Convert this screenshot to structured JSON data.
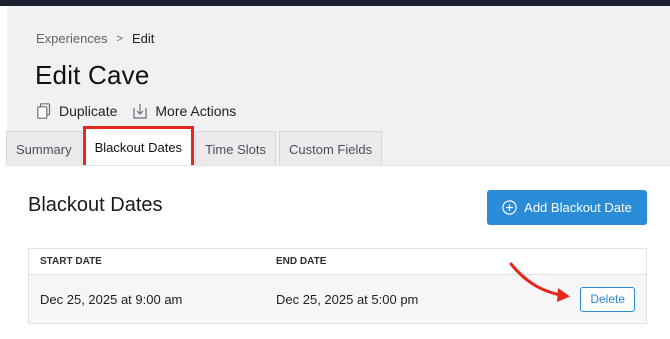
{
  "breadcrumb": {
    "parent": "Experiences",
    "separator": ">",
    "current": "Edit"
  },
  "page": {
    "title": "Edit Cave"
  },
  "actions": [
    {
      "label": "Duplicate",
      "icon": "duplicate-icon"
    },
    {
      "label": "More Actions",
      "icon": "download-icon"
    }
  ],
  "tabs": [
    {
      "label": "Summary",
      "active": false
    },
    {
      "label": "Blackout Dates",
      "active": true
    },
    {
      "label": "Time Slots",
      "active": false
    },
    {
      "label": "Custom Fields",
      "active": false
    }
  ],
  "section": {
    "title": "Blackout Dates",
    "add_button_label": "Add Blackout Date",
    "add_button_icon": "plus-circle-icon"
  },
  "table": {
    "columns": [
      "START DATE",
      "END DATE"
    ],
    "rows": [
      {
        "start": "Dec 25, 2025 at 9:00 am",
        "end": "Dec 25, 2025 at 5:00 pm",
        "action": "Delete"
      }
    ]
  },
  "colors": {
    "accent": "#2a8bd6",
    "highlight": "#e5261d",
    "topbar": "#1c2130"
  }
}
